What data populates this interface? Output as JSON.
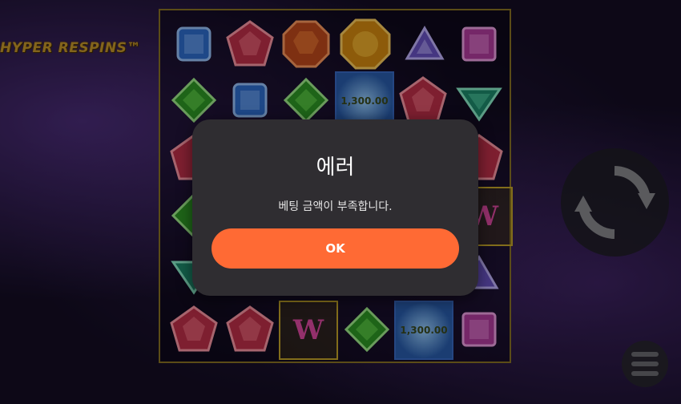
{
  "game": {
    "logo_text": "HYPER RESPINS™",
    "prize_value_1": "1,300.00",
    "prize_value_2": "1,300.00",
    "wild_symbol_1": "W",
    "wild_symbol_2": "W"
  },
  "dialog": {
    "title": "에러",
    "message": "베팅 금액이 부족합니다.",
    "ok_label": "OK"
  },
  "colors": {
    "accent": "#ff6a34",
    "dialog_bg": "#2f2d31",
    "board_border": "#8c7524"
  },
  "controls": {
    "spin_icon": "refresh-icon",
    "menu_icon": "hamburger-menu-icon"
  }
}
